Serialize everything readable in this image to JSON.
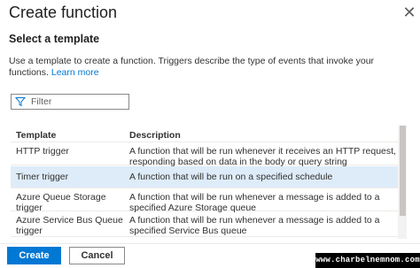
{
  "panel": {
    "title": "Create function",
    "close_icon": "close-icon"
  },
  "template_section": {
    "heading": "Select a template",
    "description": "Use a template to create a function. Triggers describe the type of events that invoke your functions.",
    "learn_more": "Learn more"
  },
  "filter": {
    "placeholder": "Filter",
    "icon": "funnel-icon"
  },
  "table": {
    "headers": {
      "template": "Template",
      "description": "Description"
    },
    "rows": [
      {
        "template": "HTTP trigger",
        "description": "A function that will be run whenever it receives an HTTP request, responding based on data in the body or query string"
      },
      {
        "template": "Timer trigger",
        "description": "A function that will be run on a specified schedule"
      },
      {
        "template": "Azure Queue Storage trigger",
        "description": "A function that will be run whenever a message is added to a specified Azure Storage queue"
      },
      {
        "template": "Azure Service Bus Queue trigger",
        "description": "A function that will be run whenever a message is added to a specified Service Bus queue"
      }
    ],
    "selected_index": 1
  },
  "footer": {
    "create_label": "Create",
    "cancel_label": "Cancel"
  },
  "watermark": {
    "text": "www.charbelnemnom.com"
  },
  "colors": {
    "accent": "#0078d4",
    "selected_row": "#deecf9",
    "border": "#8a8886"
  }
}
